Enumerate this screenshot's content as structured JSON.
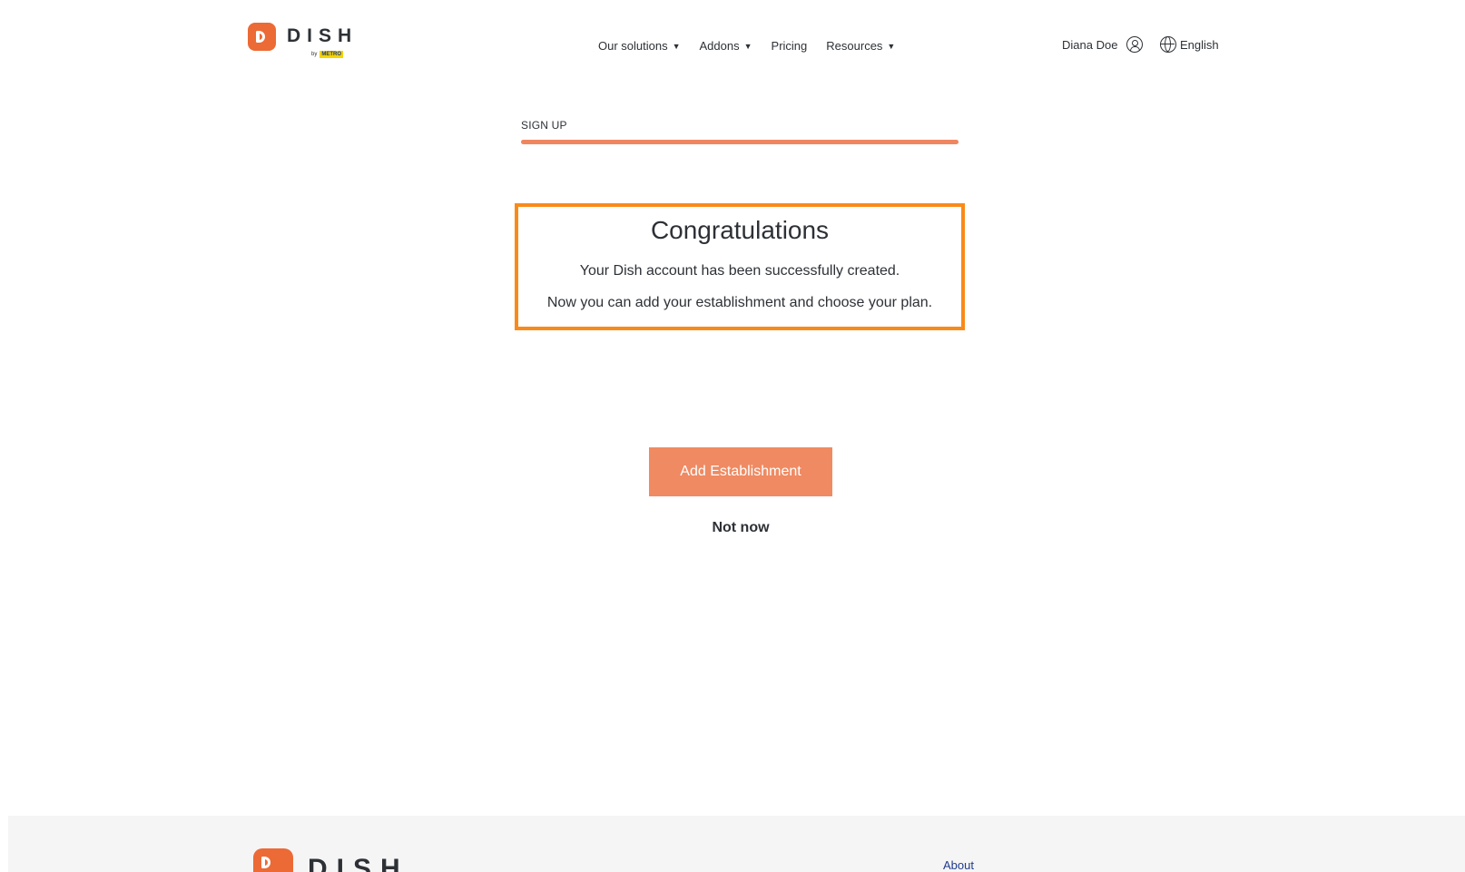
{
  "header": {
    "logo_text": "DISH",
    "logo_by": "by",
    "logo_metro": "METRO",
    "nav": [
      {
        "label": "Our solutions",
        "has_dropdown": true
      },
      {
        "label": "Addons",
        "has_dropdown": true
      },
      {
        "label": "Pricing",
        "has_dropdown": false
      },
      {
        "label": "Resources",
        "has_dropdown": true
      }
    ],
    "caret": "▼",
    "user_name": "Diana Doe",
    "language": "English"
  },
  "signup": {
    "step_label": "SIGN UP",
    "progress": 1.0
  },
  "congrats": {
    "title": "Congratulations",
    "line1": "Your Dish account has been successfully created.",
    "line2": "Now you can add your establishment and choose your plan."
  },
  "actions": {
    "add_establishment": "Add Establishment",
    "not_now": "Not now"
  },
  "footer": {
    "logo_text": "DISH",
    "about": "About"
  },
  "colors": {
    "brand": "#ec6a35",
    "button": "#ef8a62",
    "highlight_border": "#f98a1a"
  }
}
